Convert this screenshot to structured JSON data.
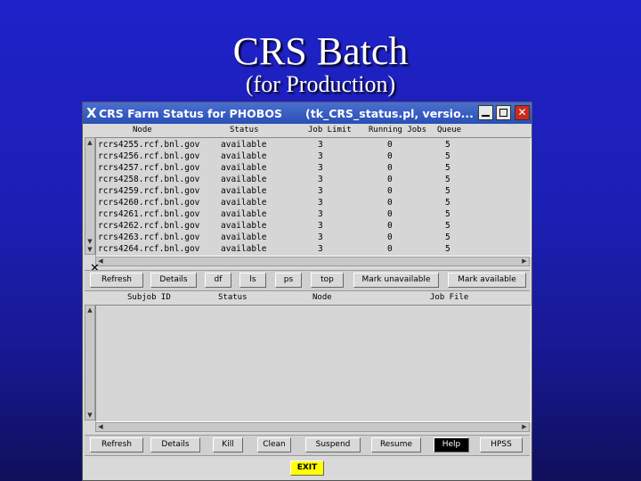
{
  "slide": {
    "title": "CRS Batch",
    "subtitle": "(for Production)"
  },
  "window": {
    "title": "CRS Farm Status for PHOBOS",
    "title_file": "(tk_CRS_status.pl, versio...",
    "close_glyph": "✕",
    "x_logo": "X"
  },
  "farm_table": {
    "headers": [
      "Node",
      "Status",
      "Job Limit",
      "Running Jobs",
      "Queue"
    ],
    "rows": [
      [
        "rcrs4255.rcf.bnl.gov",
        "available",
        "3",
        "0",
        "5"
      ],
      [
        "rcrs4256.rcf.bnl.gov",
        "available",
        "3",
        "0",
        "5"
      ],
      [
        "rcrs4257.rcf.bnl.gov",
        "available",
        "3",
        "0",
        "5"
      ],
      [
        "rcrs4258.rcf.bnl.gov",
        "available",
        "3",
        "0",
        "5"
      ],
      [
        "rcrs4259.rcf.bnl.gov",
        "available",
        "3",
        "0",
        "5"
      ],
      [
        "rcrs4260.rcf.bnl.gov",
        "available",
        "3",
        "0",
        "5"
      ],
      [
        "rcrs4261.rcf.bnl.gov",
        "available",
        "3",
        "0",
        "5"
      ],
      [
        "rcrs4262.rcf.bnl.gov",
        "available",
        "3",
        "0",
        "5"
      ],
      [
        "rcrs4263.rcf.bnl.gov",
        "available",
        "3",
        "0",
        "5"
      ],
      [
        "rcrs4264.rcf.bnl.gov",
        "available",
        "3",
        "0",
        "5"
      ]
    ]
  },
  "farm_buttons": {
    "refresh": "Refresh",
    "details": "Details",
    "df": "df",
    "ls": "ls",
    "ps": "ps",
    "top": "top",
    "mark_unavailable": "Mark unavailable",
    "mark_available": "Mark available"
  },
  "job_table": {
    "headers": [
      "Subjob ID",
      "Status",
      "Node",
      "Job File"
    ]
  },
  "job_buttons": {
    "refresh": "Refresh",
    "details": "Details",
    "kill": "Kill",
    "clean": "Clean",
    "suspend": "Suspend",
    "resume": "Resume",
    "help": "Help",
    "hpss": "HPSS"
  },
  "exit_label": "EXIT"
}
